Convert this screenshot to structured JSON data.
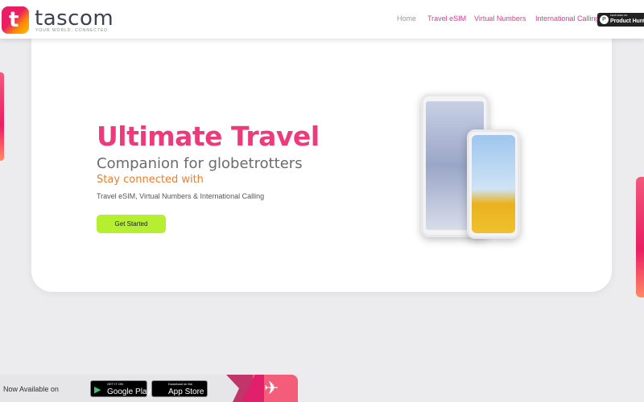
{
  "header": {
    "logo_letter": "t",
    "brand": "tascom",
    "tagline": "YOUR WORLD, CONNECTED",
    "nav": [
      "Home",
      "Travel eSIM",
      "Virtual Numbers",
      "International Calling"
    ],
    "product_hunt": {
      "small": "FEATURED ON",
      "label": "Product Hunt"
    }
  },
  "hero": {
    "title": "Ultimate Travel",
    "subtitle": "Companion for globetrotters",
    "tagline": "Stay connected with",
    "description": "Travel eSIM, Virtual Numbers & International Calling",
    "cta": "Get Started"
  },
  "footer": {
    "available": "Now Available on",
    "google_play": {
      "small": "GET IT ON",
      "label": "Google Play"
    },
    "app_store": {
      "small": "Download on the",
      "label": "App Store"
    }
  },
  "colors": {
    "brand_pink": "#ee3a7a",
    "accent_orange": "#f47c2a",
    "cta_green": "#b5ef2f"
  }
}
